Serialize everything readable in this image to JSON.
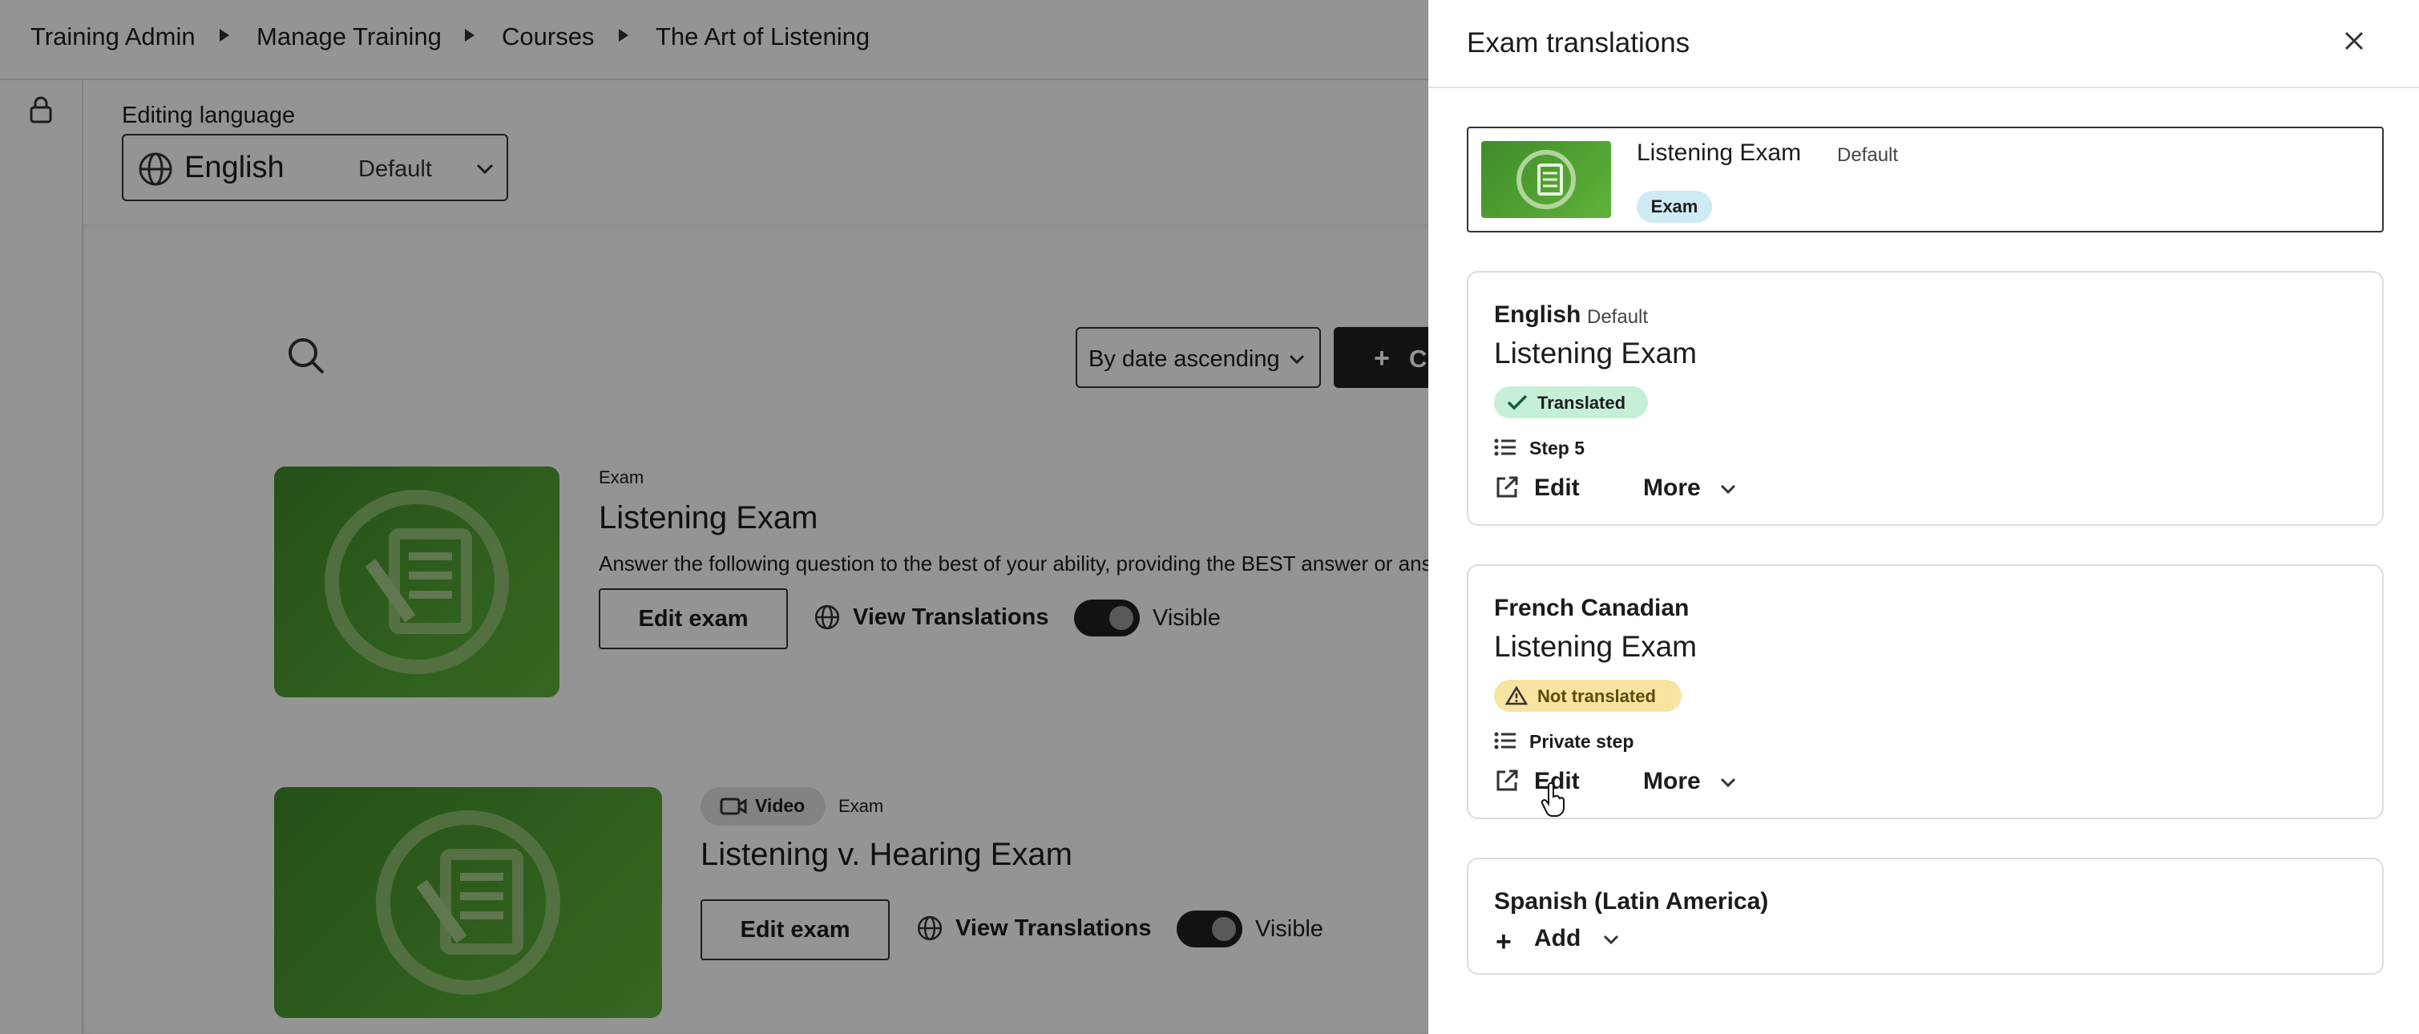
{
  "breadcrumb": [
    "Training Admin",
    "Manage Training",
    "Courses",
    "The Art of Listening"
  ],
  "editing_language": {
    "label": "Editing language",
    "value": "English",
    "default_tag": "Default"
  },
  "toolbar": {
    "sort_value": "By date ascending",
    "create_label": "C"
  },
  "exams": [
    {
      "type_label": "Exam",
      "title": "Listening Exam",
      "description": "Answer the following question to the best of your ability, providing the BEST answer or answ",
      "edit_label": "Edit exam",
      "translations_label": "View Translations",
      "visible_label": "Visible"
    },
    {
      "media_chip": "Video",
      "type_label": "Exam",
      "title": "Listening v. Hearing Exam",
      "edit_label": "Edit exam",
      "translations_label": "View Translations",
      "visible_label": "Visible"
    }
  ],
  "panel": {
    "title": "Exam translations",
    "summary": {
      "title": "Listening Exam",
      "default_tag": "Default",
      "badge": "Exam"
    },
    "languages": [
      {
        "name": "English",
        "default_tag": "Default",
        "exam_title": "Listening Exam",
        "status": "Translated",
        "step": "Step 5",
        "edit_label": "Edit",
        "more_label": "More"
      },
      {
        "name": "French Canadian",
        "exam_title": "Listening Exam",
        "status": "Not translated",
        "step": "Private step",
        "edit_label": "Edit",
        "more_label": "More"
      },
      {
        "name": "Spanish (Latin America)",
        "add_label": "Add"
      }
    ]
  },
  "colors": {
    "thumb_green": "#4f9f31",
    "translated_badge": "#c6efd7",
    "not_translated_badge": "#f6e4a0",
    "exam_badge": "#cdeaf5",
    "overlay": "rgba(0,0,0,0.42)"
  },
  "icons": [
    "lock-icon",
    "globe-icon",
    "chevron-down-icon",
    "search-icon",
    "plus-icon",
    "document-icon",
    "video-icon",
    "close-icon",
    "check-icon",
    "warning-icon",
    "list-icon",
    "external-link-icon"
  ]
}
